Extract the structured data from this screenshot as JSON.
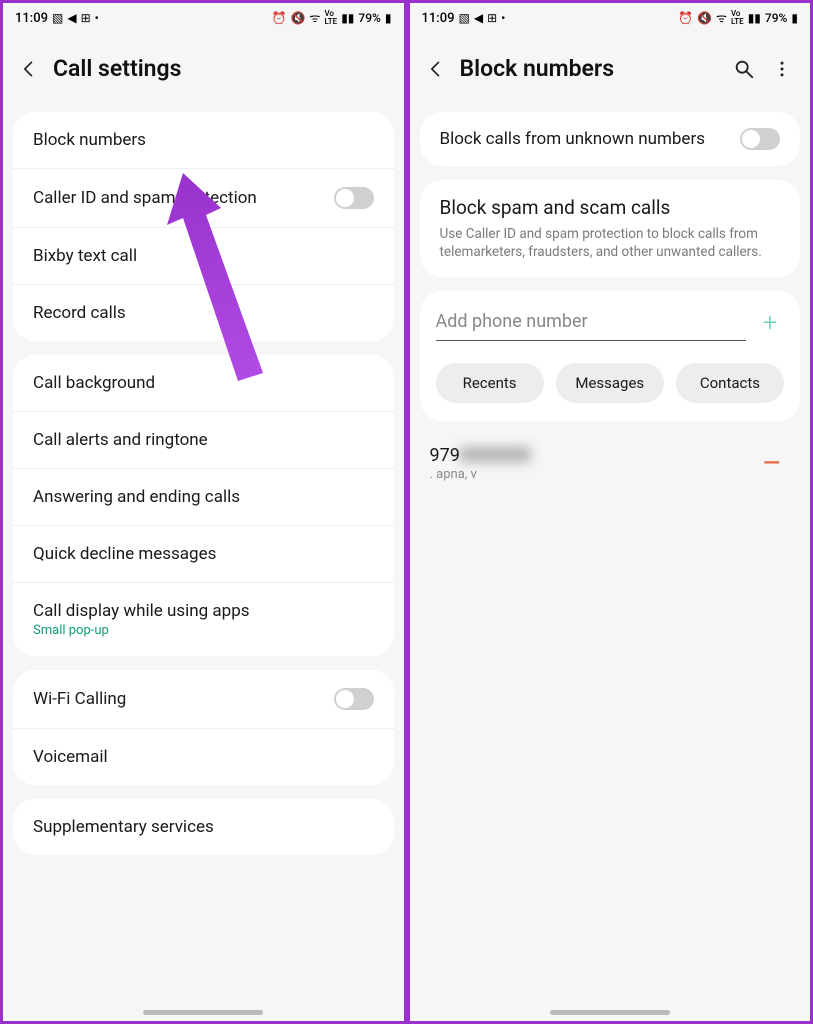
{
  "statusbar": {
    "time": "11:09",
    "battery": "79%"
  },
  "left": {
    "title": "Call settings",
    "group1": [
      {
        "label": "Block numbers"
      },
      {
        "label": "Caller ID and spam protection",
        "toggle": true
      },
      {
        "label": "Bixby text call"
      },
      {
        "label": "Record calls"
      }
    ],
    "group2": [
      {
        "label": "Call background"
      },
      {
        "label": "Call alerts and ringtone"
      },
      {
        "label": "Answering and ending calls"
      },
      {
        "label": "Quick decline messages"
      },
      {
        "label": "Call display while using apps",
        "sub": "Small pop-up"
      }
    ],
    "group3": [
      {
        "label": "Wi-Fi Calling",
        "toggle": true
      },
      {
        "label": "Voicemail"
      }
    ],
    "group4": [
      {
        "label": "Supplementary services"
      }
    ]
  },
  "right": {
    "title": "Block numbers",
    "block_unknown": {
      "label": "Block calls from unknown numbers"
    },
    "spam": {
      "title": "Block spam and scam calls",
      "desc": "Use Caller ID and spam protection to block calls from telemarketers, fraudsters, and other unwanted callers."
    },
    "add": {
      "placeholder": "Add phone number",
      "chips": [
        "Recents",
        "Messages",
        "Contacts"
      ]
    },
    "blocked": {
      "number_prefix": "979",
      "number_hidden": "0000000",
      "subtitle": ". apna, v"
    }
  },
  "colors": {
    "accent_green": "#0e9e7a",
    "arrow": "#9932cc"
  }
}
